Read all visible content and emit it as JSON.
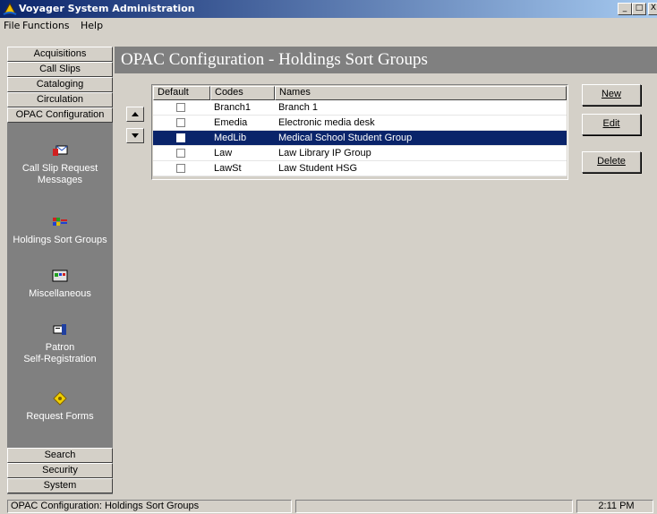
{
  "window": {
    "title": "Voyager System Administration",
    "controls": {
      "minimize": "_",
      "maximize": "□",
      "close": "X"
    }
  },
  "menu": [
    "File",
    "Functions",
    "Help"
  ],
  "nav": {
    "top_buttons": [
      "Acquisitions",
      "Call Slips",
      "Cataloging",
      "Circulation",
      "OPAC Configuration"
    ],
    "tasks": [
      {
        "label_lines": [
          "Call Slip Request",
          "Messages"
        ],
        "icon": "call-slip-messages-icon"
      },
      {
        "label_lines": [
          "Holdings Sort Groups"
        ],
        "icon": "holdings-sort-groups-icon"
      },
      {
        "label_lines": [
          "Miscellaneous"
        ],
        "icon": "miscellaneous-icon"
      },
      {
        "label_lines": [
          "Patron",
          "Self-Registration"
        ],
        "icon": "patron-self-registration-icon"
      },
      {
        "label_lines": [
          "Request Forms"
        ],
        "icon": "request-forms-icon"
      }
    ],
    "bottom_buttons": [
      "Search",
      "Security",
      "System"
    ]
  },
  "main": {
    "title": "OPAC Configuration - Holdings Sort Groups",
    "grid": {
      "columns": [
        "Default",
        "Codes",
        "Names"
      ],
      "rows": [
        {
          "default": false,
          "code": "Branch1",
          "name": "Branch 1",
          "selected": false
        },
        {
          "default": false,
          "code": "Emedia",
          "name": "Electronic media desk",
          "selected": false
        },
        {
          "default": false,
          "code": "MedLib",
          "name": "Medical School Student Group",
          "selected": true
        },
        {
          "default": false,
          "code": "Law",
          "name": "Law Library IP Group",
          "selected": false
        },
        {
          "default": false,
          "code": "LawSt",
          "name": "Law Student HSG",
          "selected": false
        }
      ]
    },
    "buttons": {
      "new_label": "New",
      "edit_label": "Edit",
      "delete_label": "Delete"
    }
  },
  "status": {
    "message": "OPAC Configuration:  Holdings Sort Groups",
    "time": "2:11 PM"
  },
  "colors": {
    "title_bar": "#0a246a",
    "selection": "#0a246a",
    "nav_background": "#808080",
    "face": "#d4d0c8"
  }
}
